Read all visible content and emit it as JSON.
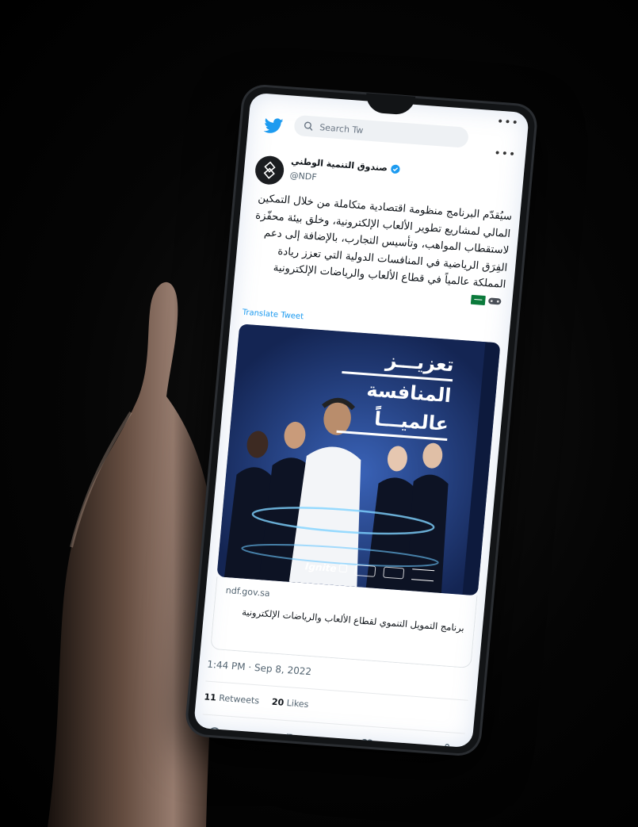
{
  "search": {
    "placeholder": "Search Tw"
  },
  "tweet": {
    "author_name": "صندوق التنمية الوطني",
    "author_handle": "@NDF",
    "text": "سيُقدّم البرنامج منظومة اقتصادية متكاملة من خلال التمكين المالي لمشاريع تطوير الألعاب الإلكترونية، وخلق بيئة محفّزة لاستقطاب المواهب، وتأسيس التجارب، بالإضافة إلى دعم الفِرَق الرياضية في المنافسات الدولية التي تعزز ريادة المملكة عالمياً في قطاع الألعاب والرياضات الإلكترونية",
    "translate_label": "Translate Tweet",
    "media_title_lines": [
      "تعزيـــز",
      "المنافسة",
      "عالميـــاً"
    ],
    "media_logo_text": "Ignite",
    "link_domain": "ndf.gov.sa",
    "link_title": "برنامج التمويل التنموي لقطاع الألعاب والرياضات الإلكترونية",
    "timestamp": "1:44 PM · Sep 8, 2022",
    "retweets_count": "11",
    "retweets_label": "Retweets",
    "likes_count": "20",
    "likes_label": "Likes"
  },
  "icons": {
    "brand": "twitter-bird-icon",
    "actions": [
      "reply-icon",
      "retweet-icon",
      "like-icon",
      "share-icon"
    ]
  },
  "colors": {
    "link_blue": "#1d9bf0",
    "media_bg": "#1a2f63",
    "flag_green": "#0b7a3b"
  }
}
